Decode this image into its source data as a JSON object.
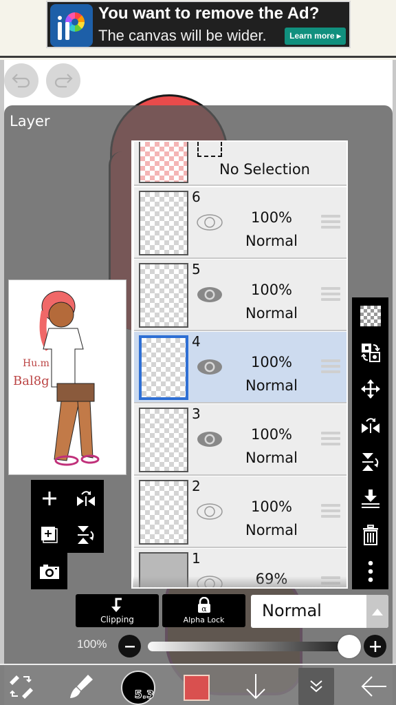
{
  "ad": {
    "title": "You want to remove the Ad?",
    "subtitle": "The canvas will be wider.",
    "button_label": "Learn more ▸",
    "logo_icon": "ibispaint-logo-icon"
  },
  "toolbar_top": {
    "undo_icon": "undo-icon",
    "redo_icon": "redo-icon"
  },
  "layer_panel": {
    "title": "Layer",
    "selection_row": {
      "label": "No Selection"
    },
    "layers": [
      {
        "number": "6",
        "opacity": "100%",
        "blend": "Normal",
        "visible": false,
        "selected": false
      },
      {
        "number": "5",
        "opacity": "100%",
        "blend": "Normal",
        "visible": true,
        "selected": false
      },
      {
        "number": "4",
        "opacity": "100%",
        "blend": "Normal",
        "visible": true,
        "selected": true
      },
      {
        "number": "3",
        "opacity": "100%",
        "blend": "Normal",
        "visible": true,
        "selected": false
      },
      {
        "number": "2",
        "opacity": "100%",
        "blend": "Normal",
        "visible": false,
        "selected": false
      },
      {
        "number": "1",
        "opacity": "69%",
        "blend": "Normal",
        "visible": false,
        "selected": false
      }
    ],
    "left_tools": [
      "add-layer-icon",
      "flip-horizontal-icon",
      "add-canvas-layer-icon",
      "flip-vertical-icon",
      "camera-icon"
    ],
    "right_tools": [
      "transparency-icon",
      "swap-layer-icon",
      "move-icon",
      "flip-horizontal-icon",
      "flip-vertical-icon",
      "merge-down-icon",
      "trash-icon",
      "more-icon"
    ],
    "clipping_label": "Clipping",
    "alpha_lock_label": "Alpha Lock",
    "blend_mode": "Normal",
    "opacity_label": "100%",
    "opacity_value": 100
  },
  "bottom_bar": {
    "brush_size": "5.3",
    "current_color": "#d9504f",
    "tools": [
      "transform-icon",
      "brush-icon",
      "brush-size-indicator",
      "color-swatch",
      "download-arrow-icon",
      "layer-menu-icon",
      "back-arrow-icon"
    ]
  },
  "colors": {
    "selected_layer_bg": "#cddbef",
    "selected_thumb_border": "#2e6fd4",
    "panel_bg": "#5a5a5a",
    "ad_button": "#11907e"
  }
}
